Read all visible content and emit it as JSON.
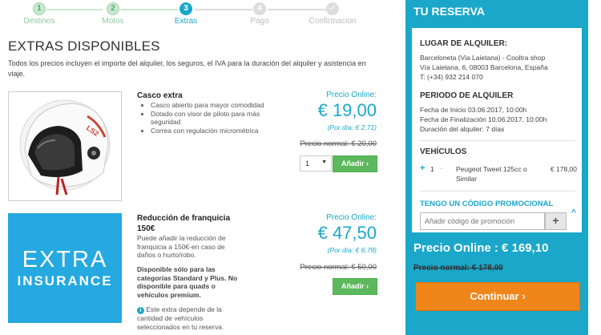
{
  "stepper": {
    "steps": [
      {
        "num": "1",
        "label": "Destinos",
        "state": "done"
      },
      {
        "num": "2",
        "label": "Motos",
        "state": "done"
      },
      {
        "num": "3",
        "label": "Extras",
        "state": "active"
      },
      {
        "num": "4",
        "label": "Pago",
        "state": "todo"
      },
      {
        "num": "5",
        "label": "Confirmacion",
        "state": "todo"
      }
    ]
  },
  "main": {
    "title": "EXTRAS DISPONIBLES",
    "intro": "Todos los precios incluyen el importe del alquiler, los seguros, el IVA para la duración del alquiler y asistencia en viaje.",
    "extras": [
      {
        "name": "Casco extra",
        "features": [
          "Casco abierto para mayor comodidad",
          "Dotado con visor de piloto para más seguridad",
          "Correa con regulación micrométrica"
        ],
        "price_label": "Precio Online:",
        "price": "€ 19,00",
        "price_per_day": "(Por día: € 2,71)",
        "normal_price": "Precio normal: € 20,00",
        "quantity": "1",
        "add_label": "Añadir"
      },
      {
        "name": "Reducción de franquicia 150€",
        "image_line1": "EXTRA",
        "image_line2": "INSURANCE",
        "description": "Puede añadir la reducción de franquicia a 150€-en caso de daños o hurto/robo.",
        "availability": "Disponible sólo para las categorías Standard y Plus. No disponible para quads o vehículos premium.",
        "note": "Este extra depende de la cantidad de vehículos seleccionados en tu reserva.",
        "price_label": "Precio Online:",
        "price": "€ 47,50",
        "price_per_day": "(Por día: € 6,79)",
        "normal_price": "Precio normal: € 50,00",
        "add_label": "Añadir"
      }
    ]
  },
  "reservation": {
    "title": "TU RESERVA",
    "location_heading": "LUGAR DE ALQUILER:",
    "location_lines": [
      "Barceloneta (Via Laietana) - Cooltra shop",
      "Vía Laietana, 6, 08003 Barcelona, España",
      "T: (+34) 932 214 070"
    ],
    "period_heading": "PERIODO DE ALQUILER",
    "period_lines": [
      "Fecha de Inicio 03.06.2017, 10:00h",
      "Fecha de Finalización 10.06.2017, 10:00h",
      "Duración del alquiler: 7 días"
    ],
    "vehicles_heading": "VEHÍCULOS",
    "vehicle": {
      "qty": "1",
      "name": "Peugeot Tweet 125cc o Similar",
      "price": "€ 178,00"
    },
    "promo_heading": "TENGO UN CÓDIGO PROMOCIONAL",
    "promo_placeholder": "Añadir código de promoción",
    "total": "Precio Online : € 169,10",
    "total_normal": "Precio normal: € 178,00",
    "continue_label": "Continuar"
  },
  "colors": {
    "accent": "#1aa7c9",
    "add_green": "#5cb85c",
    "continue_orange": "#f08519"
  }
}
